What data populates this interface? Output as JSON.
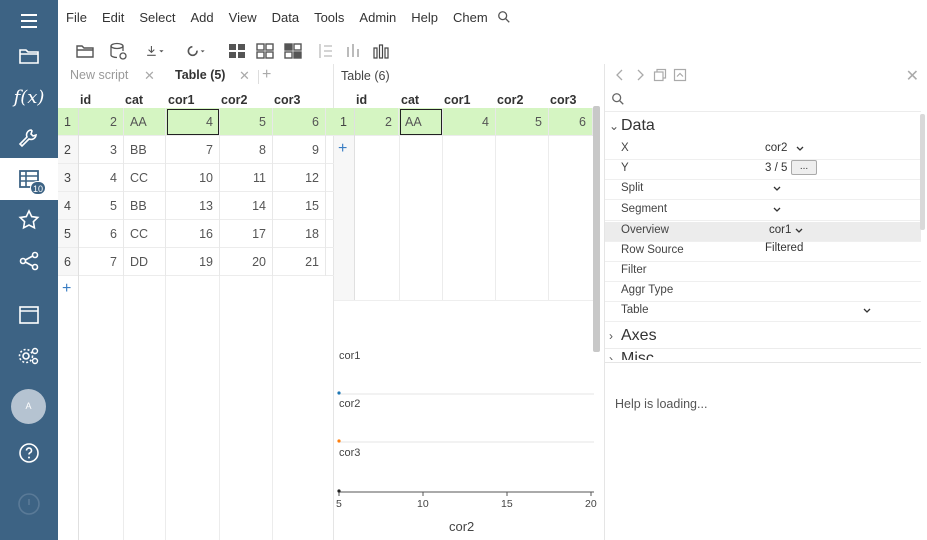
{
  "sidebar": {
    "badge": "10",
    "avatar_initial": "A",
    "fx_label": "f(x)"
  },
  "menu": [
    "File",
    "Edit",
    "Select",
    "Add",
    "View",
    "Data",
    "Tools",
    "Admin",
    "Help",
    "Chem"
  ],
  "tabs": {
    "tab1": "New script",
    "tab2": "Table (5)"
  },
  "left_grid": {
    "columns": [
      "id",
      "cat",
      "cor1",
      "cor2",
      "cor3"
    ],
    "rows": [
      {
        "idx": "1",
        "id": "2",
        "cat": "AA",
        "cor1": "4",
        "cor2": "5",
        "cor3": "6"
      },
      {
        "idx": "2",
        "id": "3",
        "cat": "BB",
        "cor1": "7",
        "cor2": "8",
        "cor3": "9"
      },
      {
        "idx": "3",
        "id": "4",
        "cat": "CC",
        "cor1": "10",
        "cor2": "11",
        "cor3": "12"
      },
      {
        "idx": "4",
        "id": "5",
        "cat": "BB",
        "cor1": "13",
        "cor2": "14",
        "cor3": "15"
      },
      {
        "idx": "5",
        "id": "6",
        "cat": "CC",
        "cor1": "16",
        "cor2": "17",
        "cor3": "18"
      },
      {
        "idx": "6",
        "id": "7",
        "cat": "DD",
        "cor1": "19",
        "cor2": "20",
        "cor3": "21"
      }
    ]
  },
  "mid": {
    "title": "Table (6)",
    "columns": [
      "id",
      "cat",
      "cor1",
      "cor2",
      "cor3"
    ],
    "row": {
      "idx": "1",
      "id": "2",
      "cat": "AA",
      "cor1": "4",
      "cor2": "5",
      "cor3": "6"
    }
  },
  "chart_data": {
    "type": "scatter",
    "subplots": [
      "cor1",
      "cor2",
      "cor3"
    ],
    "xlabel": "cor2",
    "x_ticks": [
      "5",
      "10",
      "15",
      "20"
    ],
    "xlim": [
      5,
      20
    ],
    "colors": [
      "#1f77b4",
      "#ff7f0e",
      "#222222"
    ]
  },
  "props": {
    "data_section": "Data",
    "axes_section": "Axes",
    "misc_section": "Misc",
    "rows": [
      {
        "name": "X",
        "value": "cor2"
      },
      {
        "name": "Y",
        "value": "3 / 5"
      },
      {
        "name": "Split",
        "value": ""
      },
      {
        "name": "Segment",
        "value": ""
      },
      {
        "name": "Overview",
        "value": "cor1"
      },
      {
        "name": "Row Source",
        "value": "Filtered"
      },
      {
        "name": "Filter",
        "value": ""
      },
      {
        "name": "Aggr Type",
        "value": ""
      },
      {
        "name": "Table",
        "value": ""
      }
    ],
    "dots_label": "..."
  },
  "help_text": "Help is loading..."
}
